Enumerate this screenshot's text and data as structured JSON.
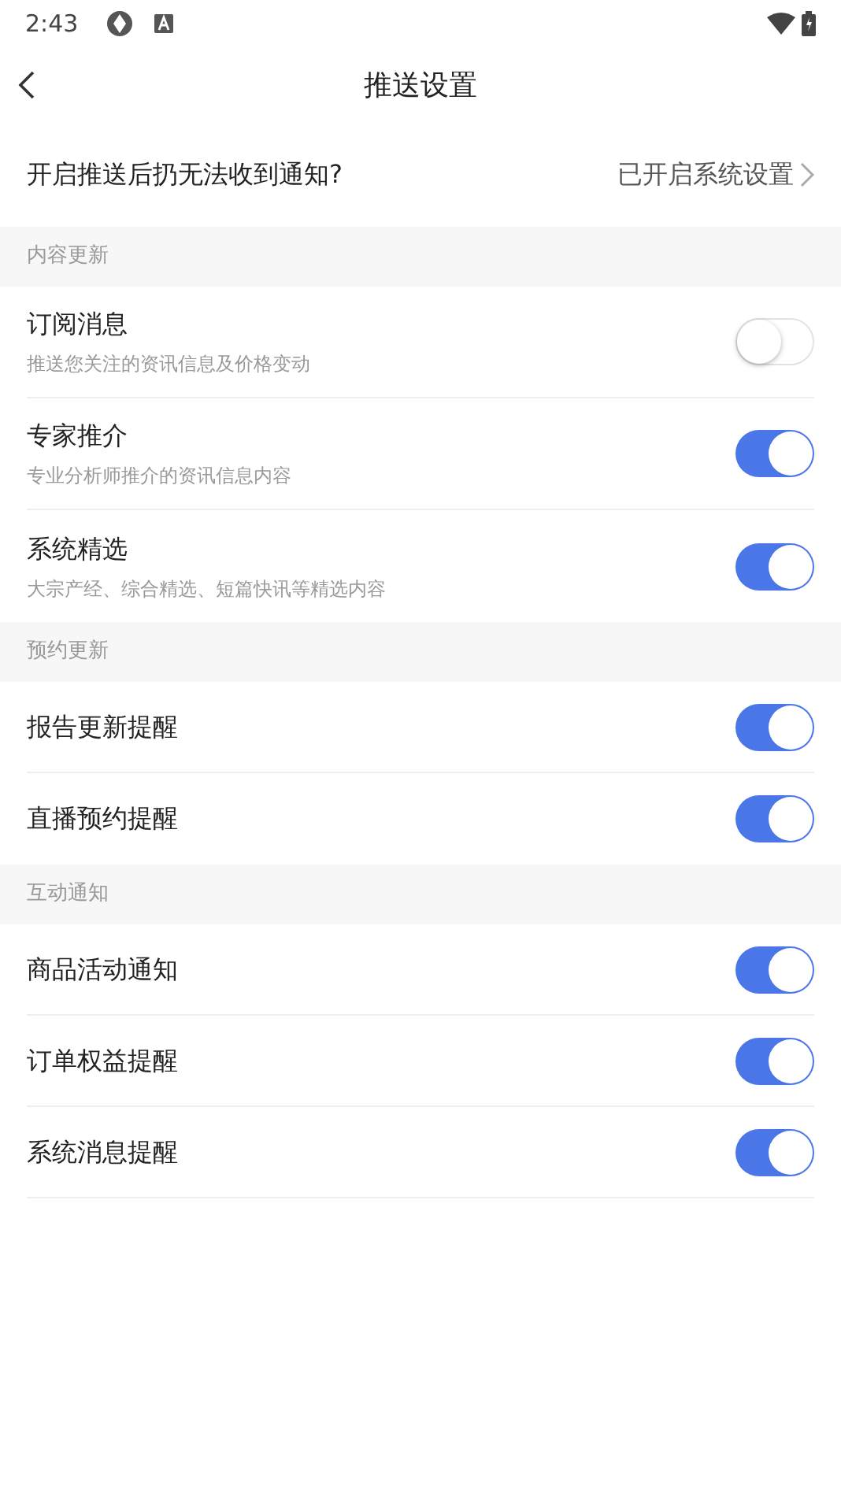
{
  "status_bar": {
    "time": "2:43"
  },
  "header": {
    "title": "推送设置"
  },
  "system_row": {
    "label": "开启推送后扔无法收到通知?",
    "value": "已开启系统设置"
  },
  "sections": [
    {
      "title": "内容更新",
      "items": [
        {
          "label": "订阅消息",
          "subtitle": "推送您关注的资讯信息及价格变动",
          "on": false
        },
        {
          "label": "专家推介",
          "subtitle": "专业分析师推介的资讯信息内容",
          "on": true
        },
        {
          "label": "系统精选",
          "subtitle": "大宗产经、综合精选、短篇快讯等精选内容",
          "on": true
        }
      ]
    },
    {
      "title": "预约更新",
      "items": [
        {
          "label": "报告更新提醒",
          "on": true
        },
        {
          "label": "直播预约提醒",
          "on": true
        }
      ]
    },
    {
      "title": "互动通知",
      "items": [
        {
          "label": "商品活动通知",
          "on": true
        },
        {
          "label": "订单权益提醒",
          "on": true
        },
        {
          "label": "系统消息提醒",
          "on": true
        }
      ]
    }
  ]
}
